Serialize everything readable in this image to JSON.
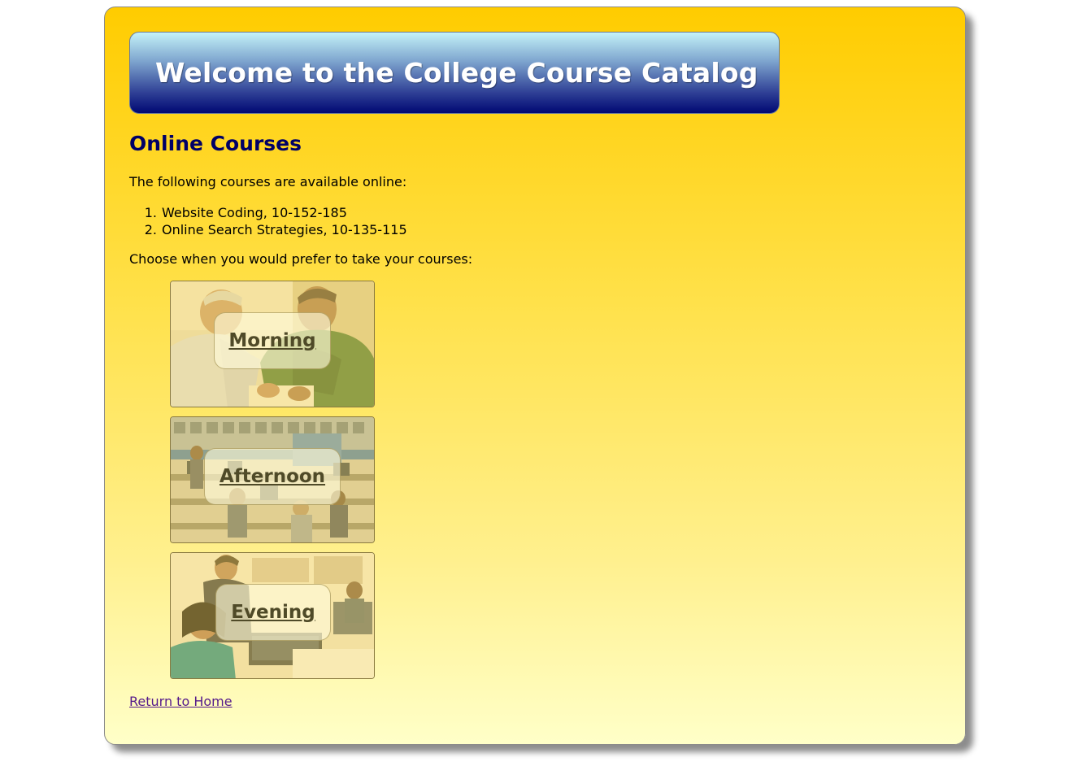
{
  "header": {
    "title": "Welcome to the College Course Catalog"
  },
  "main": {
    "section_title": "Online Courses",
    "intro": "The following courses are available online:",
    "courses": [
      {
        "number": "1.",
        "label": "Website Coding, 10-152-185"
      },
      {
        "number": "2.",
        "label": "Online Search Strategies, 10-135-115"
      }
    ],
    "prompt": "Choose when you would prefer to take your courses:",
    "time_options": [
      {
        "label": "Morning",
        "image": "two-men-reviewing-document-photo"
      },
      {
        "label": "Afternoon",
        "image": "computer-lab-students-photo"
      },
      {
        "label": "Evening",
        "image": "instructor-helping-students-photo"
      }
    ]
  },
  "footer": {
    "home_link": "Return to Home"
  },
  "colors": {
    "page_gradient_top": "#ffcc00",
    "page_gradient_bottom": "#ffffc8",
    "banner_top": "#c4f2f8",
    "banner_bottom": "#000873",
    "heading": "#000066",
    "visited_link": "#551a8b",
    "tile_label": "#4f4a28"
  }
}
